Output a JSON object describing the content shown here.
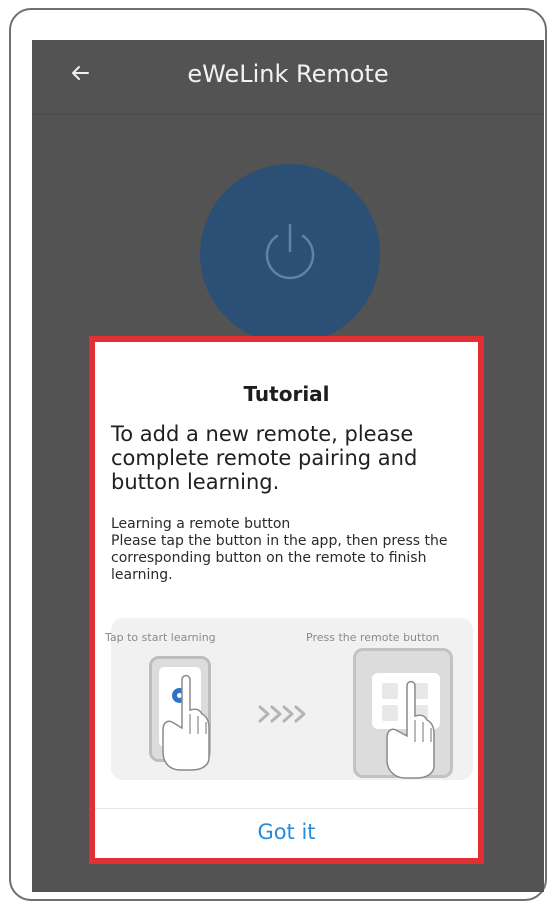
{
  "app": {
    "title": "eWeLink Remote"
  },
  "dialog": {
    "title": "Tutorial",
    "main_text": "To add a new remote, please complete remote pairing and button learning.",
    "section_title": "Learning a remote button",
    "section_body": "Please tap the button in the app, then press the corresponding button on the remote to finish learning.",
    "illustration": {
      "left_label": "Tap to start learning",
      "right_label": "Press the remote button"
    },
    "confirm_label": "Got it"
  },
  "icons": {
    "back": "arrow-left-icon",
    "power": "power-icon"
  },
  "colors": {
    "overlay_bg": "#535353",
    "power_button": "#2c4f75",
    "highlight_border": "#e12f34",
    "action_blue": "#2a8bd8"
  }
}
